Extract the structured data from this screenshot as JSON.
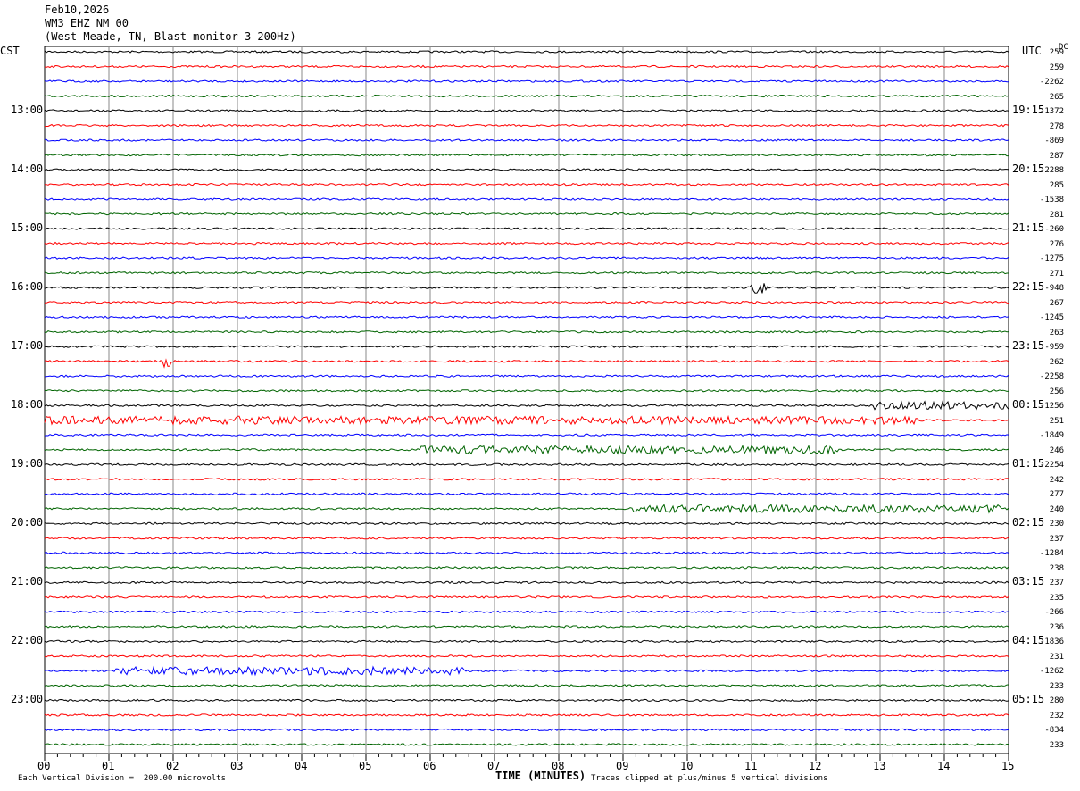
{
  "header": {
    "line1": "Feb10,2026",
    "line2": "WM3 EHZ NM 00",
    "line3": "(West Meade, TN, Blast monitor 3 200Hz)"
  },
  "left_tz": "CST",
  "right_tz": "UTC",
  "dc_label": "DC",
  "footer": {
    "xlabel": "TIME (MINUTES)",
    "scale": "Each Vertical Division =  200.00 microvolts",
    "clip": "Traces clipped at plus/minus 5 vertical divisions"
  },
  "chart_data": {
    "type": "line",
    "title": "WM3 EHZ NM 00 helicorder",
    "xlabel": "TIME (MINUTES)",
    "xlim": [
      0,
      15
    ],
    "x_ticks": [
      "00",
      "01",
      "02",
      "03",
      "04",
      "05",
      "06",
      "07",
      "08",
      "09",
      "10",
      "11",
      "12",
      "13",
      "14",
      "15"
    ],
    "trace_colors": [
      "#000000",
      "#ff0000",
      "#0000ff",
      "#006400"
    ],
    "left_hour_labels": [
      "13:00",
      "14:00",
      "15:00",
      "16:00",
      "17:00",
      "18:00",
      "19:00",
      "20:00",
      "21:00",
      "22:00",
      "23:00"
    ],
    "right_hour_labels": [
      "19:15",
      "20:15",
      "21:15",
      "22:15",
      "23:15",
      "00:15",
      "01:15",
      "02:15",
      "03:15",
      "04:15",
      "05:15"
    ],
    "dc_offsets": [
      259,
      259,
      -2262,
      265,
      -1372,
      278,
      -869,
      287,
      -2288,
      285,
      -1538,
      281,
      -260,
      276,
      -1275,
      271,
      -948,
      267,
      -1245,
      263,
      -959,
      262,
      -2258,
      256,
      -1256,
      251,
      -1849,
      246,
      -2254,
      242,
      277,
      240,
      230,
      237,
      -1284,
      238,
      237,
      235,
      -266,
      236,
      -1836,
      231,
      -1262,
      233,
      280,
      232,
      -834,
      233
    ],
    "events": [
      {
        "trace": 24,
        "start": 12.9,
        "end": 15,
        "amplitude": "high"
      },
      {
        "trace": 25,
        "start": 0,
        "end": 13.6,
        "amplitude": "high"
      },
      {
        "trace": 27,
        "start": 5.85,
        "end": 12.35,
        "amplitude": "high"
      },
      {
        "trace": 31,
        "start": 9.15,
        "end": 14.9,
        "amplitude": "high"
      },
      {
        "trace": 42,
        "start": 1.1,
        "end": 6.55,
        "amplitude": "high"
      },
      {
        "trace": 21,
        "start": 1.85,
        "end": 1.95,
        "amplitude": "spike"
      },
      {
        "trace": 16,
        "start": 11.0,
        "end": 11.25,
        "amplitude": "spike"
      }
    ]
  }
}
